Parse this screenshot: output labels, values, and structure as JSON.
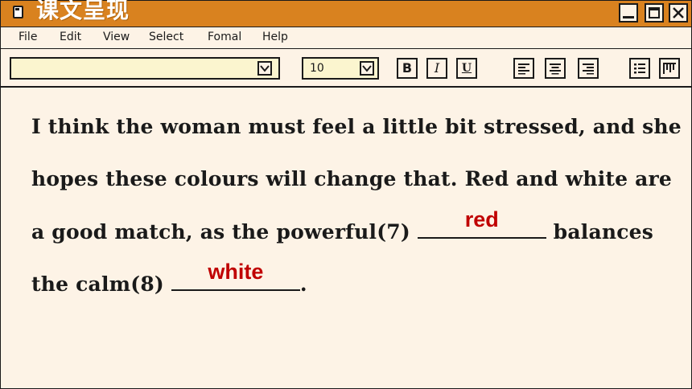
{
  "window": {
    "title": "课文呈现"
  },
  "menu": [
    "File",
    "Edit",
    "View",
    "Select",
    "Fomal",
    "Help"
  ],
  "toolbar": {
    "font_value": "",
    "size_value": "10",
    "bold_label": "B",
    "italic_label": "I",
    "underline_label": "U"
  },
  "document": {
    "line1": "I think the woman must feel a little bit stressed, and she",
    "line2": "hopes these colours will change that. Red and white are",
    "line3_before": "a good match, as the powerful(7) ",
    "line3_answer": "red",
    "line3_after": " balances",
    "line4_before": "the calm(8) ",
    "line4_answer": "white",
    "line4_after": "."
  },
  "colors": {
    "titlebar": "#d9821f",
    "background": "#fdf3e6",
    "answer": "#c00000",
    "input": "#fbf5cf"
  }
}
